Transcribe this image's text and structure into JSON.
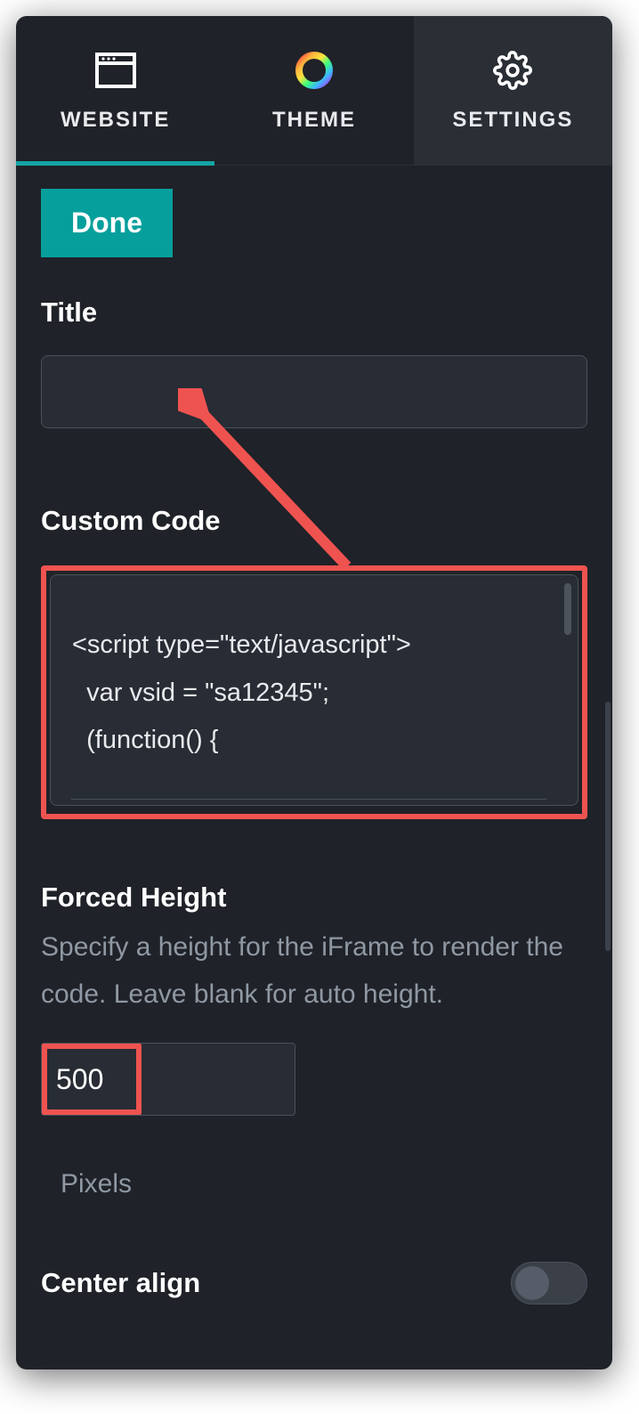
{
  "tabs": {
    "website": "WEBSITE",
    "theme": "THEME",
    "settings": "SETTINGS"
  },
  "done_label": "Done",
  "title": {
    "label": "Title",
    "value": ""
  },
  "custom_code": {
    "label": "Custom Code",
    "value": "<script type=\"text/javascript\">\n  var vsid = \"sa12345\";\n  (function() {"
  },
  "forced_height": {
    "label": "Forced Height",
    "help": "Specify a height for the iFrame to render the code. Leave blank for auto height.",
    "value": "500",
    "units": "Pixels"
  },
  "center_align": {
    "label": "Center align",
    "value": false
  },
  "colors": {
    "accent": "#069f9c",
    "highlight": "#ef5350",
    "panel": "#1f2228"
  }
}
